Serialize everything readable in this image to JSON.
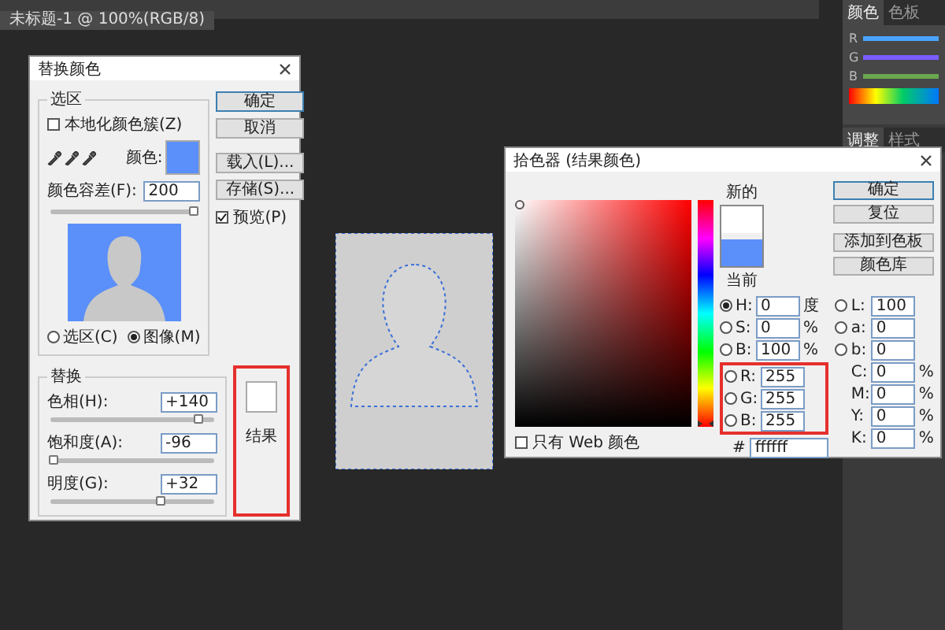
{
  "document_tab": {
    "title": "未标题-1 @ 100%(RGB/8)"
  },
  "side_panel": {
    "color_tabs": [
      {
        "label": "颜色",
        "selected": true
      },
      {
        "label": "色板",
        "selected": false
      }
    ],
    "channels": [
      {
        "label": "R",
        "color": "#4aa3ff"
      },
      {
        "label": "G",
        "color": "#7a5cff"
      },
      {
        "label": "B",
        "color": "#6aa84f"
      }
    ],
    "adjust_tabs": [
      {
        "label": "调整",
        "selected": true
      },
      {
        "label": "样式",
        "selected": false
      }
    ]
  },
  "replace_color": {
    "title": "替换颜色",
    "selection": {
      "legend": "选区",
      "localized": {
        "label": "本地化颜色簇(Z)",
        "checked": false
      },
      "color_label": "颜色:",
      "color": "#5b8ff9",
      "fuzziness_label": "颜色容差(F):",
      "fuzziness": "200",
      "fuzziness_slider": {
        "level": 0.98
      },
      "view_options": [
        {
          "label": "选区(C)",
          "selected": false
        },
        {
          "label": "图像(M)",
          "selected": true
        }
      ]
    },
    "buttons": [
      "确定",
      "取消",
      "载入(L)...",
      "存储(S)..."
    ],
    "preview": {
      "label": "预览(P)",
      "checked": true
    },
    "replacement": {
      "legend": "替换",
      "sliders": [
        {
          "label": "色相(H):",
          "value": "+140",
          "level": 0.9
        },
        {
          "label": "饱和度(A):",
          "value": "-96",
          "level": 0.02
        },
        {
          "label": "明度(G):",
          "value": "+32",
          "level": 0.67
        }
      ],
      "result_label": "结果",
      "annotated": true
    }
  },
  "color_picker": {
    "title": "拾色器 (结果颜色)",
    "new_label": "新的",
    "current_label": "当前",
    "hue_slider": {
      "level": 0
    },
    "buttons": [
      "确定",
      "复位",
      "添加到色板",
      "颜色库"
    ],
    "left_fields": [
      {
        "kind": "radio",
        "label": "H:",
        "value": "0",
        "unit": "度",
        "selected": true
      },
      {
        "kind": "radio",
        "label": "S:",
        "value": "0",
        "unit": "%",
        "selected": false
      },
      {
        "kind": "radio",
        "label": "B:",
        "value": "100",
        "unit": "%",
        "selected": false
      },
      {
        "kind": "radio",
        "label": "R:",
        "value": "255",
        "selected": false
      },
      {
        "kind": "radio",
        "label": "G:",
        "value": "255",
        "selected": false
      },
      {
        "kind": "radio",
        "label": "B:",
        "value": "255",
        "selected": false
      }
    ],
    "right_fields": [
      {
        "kind": "radio",
        "label": "L:",
        "value": "100",
        "selected": false
      },
      {
        "kind": "radio",
        "label": "a:",
        "value": "0",
        "selected": false
      },
      {
        "kind": "radio",
        "label": "b:",
        "value": "0",
        "selected": false
      },
      {
        "kind": "plain",
        "label": "C:",
        "value": "0",
        "unit": "%"
      },
      {
        "kind": "plain",
        "label": "M:",
        "value": "0",
        "unit": "%"
      },
      {
        "kind": "plain",
        "label": "Y:",
        "value": "0",
        "unit": "%"
      },
      {
        "kind": "plain",
        "label": "K:",
        "value": "0",
        "unit": "%"
      }
    ],
    "rgb_annotated": true,
    "hex_label": "#",
    "hex": "ffffff",
    "web_only": {
      "label": "只有 Web 颜色",
      "checked": false
    }
  }
}
